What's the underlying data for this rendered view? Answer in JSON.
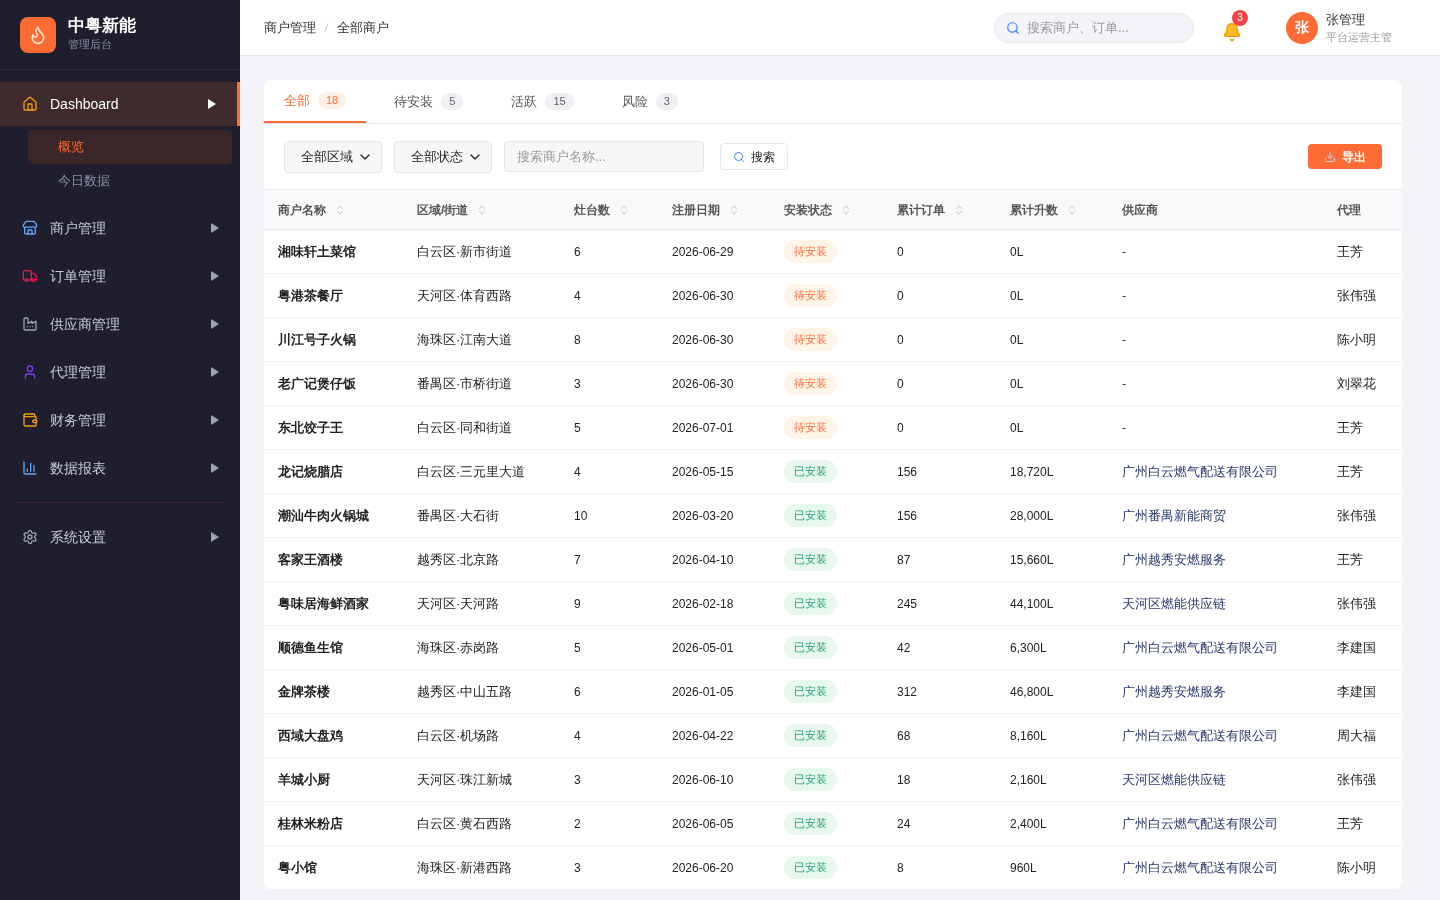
{
  "brand": {
    "name": "中粤新能",
    "subtitle": "管理后台"
  },
  "sidebar": {
    "items": [
      {
        "label": "Dashboard",
        "selected": true,
        "expanded": true,
        "children": [
          {
            "label": "概览",
            "selected": true
          },
          {
            "label": "今日数据",
            "selected": false
          }
        ]
      },
      {
        "label": "商户管理",
        "selected": false,
        "expanded": false
      },
      {
        "label": "订单管理",
        "selected": false,
        "expanded": false
      },
      {
        "label": "供应商管理",
        "selected": false,
        "expanded": false
      },
      {
        "label": "代理管理",
        "selected": false,
        "expanded": false
      },
      {
        "label": "财务管理",
        "selected": false,
        "expanded": false
      },
      {
        "label": "数据报表",
        "selected": false,
        "expanded": false
      }
    ],
    "footer_items": [
      {
        "label": "系统设置",
        "selected": false,
        "expanded": false
      }
    ]
  },
  "breadcrumb": [
    "商户管理",
    "全部商户"
  ],
  "header": {
    "search_placeholder": "搜索商户、订单...",
    "notifications": "3",
    "user": {
      "avatar": "张",
      "name": "张管理",
      "role": "平台运营主管"
    }
  },
  "tabs": [
    {
      "label": "全部",
      "count": "18",
      "selected": true
    },
    {
      "label": "待安装",
      "count": "5",
      "selected": false
    },
    {
      "label": "活跃",
      "count": "15",
      "selected": false
    },
    {
      "label": "风险",
      "count": "3",
      "selected": false
    }
  ],
  "filters": {
    "region": "全部区域",
    "status": "全部状态",
    "search_placeholder": "搜索商户名称...",
    "search_button": "搜索",
    "export_button": "导出"
  },
  "table": {
    "columns": [
      {
        "label": "商户名称",
        "sortable": true
      },
      {
        "label": "区域/街道",
        "sortable": true
      },
      {
        "label": "灶台数",
        "sortable": true
      },
      {
        "label": "注册日期",
        "sortable": true
      },
      {
        "label": "安装状态",
        "sortable": true
      },
      {
        "label": "累计订单",
        "sortable": true
      },
      {
        "label": "累计升数",
        "sortable": true
      },
      {
        "label": "供应商",
        "sortable": false
      },
      {
        "label": "代理",
        "sortable": false
      }
    ],
    "rows": [
      {
        "name": "湘味轩土菜馆",
        "area": "白云区·新市街道",
        "stoves": "6",
        "date": "2026-06-29",
        "status": {
          "kind": "pending",
          "label": "待安装"
        },
        "orders": "0",
        "liters": "0L",
        "supplier": "-",
        "agent": "王芳"
      },
      {
        "name": "粤港茶餐厅",
        "area": "天河区·体育西路",
        "stoves": "4",
        "date": "2026-06-30",
        "status": {
          "kind": "pending",
          "label": "待安装"
        },
        "orders": "0",
        "liters": "0L",
        "supplier": "-",
        "agent": "张伟强"
      },
      {
        "name": "川江号子火锅",
        "area": "海珠区·江南大道",
        "stoves": "8",
        "date": "2026-06-30",
        "status": {
          "kind": "pending",
          "label": "待安装"
        },
        "orders": "0",
        "liters": "0L",
        "supplier": "-",
        "agent": "陈小明"
      },
      {
        "name": "老广记煲仔饭",
        "area": "番禺区·市桥街道",
        "stoves": "3",
        "date": "2026-06-30",
        "status": {
          "kind": "pending",
          "label": "待安装"
        },
        "orders": "0",
        "liters": "0L",
        "supplier": "-",
        "agent": "刘翠花"
      },
      {
        "name": "东北饺子王",
        "area": "白云区·同和街道",
        "stoves": "5",
        "date": "2026-07-01",
        "status": {
          "kind": "pending",
          "label": "待安装"
        },
        "orders": "0",
        "liters": "0L",
        "supplier": "-",
        "agent": "王芳"
      },
      {
        "name": "龙记烧腊店",
        "area": "白云区·三元里大道",
        "stoves": "4",
        "date": "2026-05-15",
        "status": {
          "kind": "installed",
          "label": "已安装"
        },
        "orders": "156",
        "liters": "18,720L",
        "supplier": "广州白云燃气配送有限公司",
        "agent": "王芳"
      },
      {
        "name": "潮汕牛肉火锅城",
        "area": "番禺区·大石街",
        "stoves": "10",
        "date": "2026-03-20",
        "status": {
          "kind": "installed",
          "label": "已安装"
        },
        "orders": "156",
        "liters": "28,000L",
        "supplier": "广州番禺新能商贸",
        "agent": "张伟强"
      },
      {
        "name": "客家王酒楼",
        "area": "越秀区·北京路",
        "stoves": "7",
        "date": "2026-04-10",
        "status": {
          "kind": "installed",
          "label": "已安装"
        },
        "orders": "87",
        "liters": "15,660L",
        "supplier": "广州越秀安燃服务",
        "agent": "王芳"
      },
      {
        "name": "粤味居海鲜酒家",
        "area": "天河区·天河路",
        "stoves": "9",
        "date": "2026-02-18",
        "status": {
          "kind": "installed",
          "label": "已安装"
        },
        "orders": "245",
        "liters": "44,100L",
        "supplier": "天河区燃能供应链",
        "agent": "张伟强"
      },
      {
        "name": "顺德鱼生馆",
        "area": "海珠区·赤岗路",
        "stoves": "5",
        "date": "2026-05-01",
        "status": {
          "kind": "installed",
          "label": "已安装"
        },
        "orders": "42",
        "liters": "6,300L",
        "supplier": "广州白云燃气配送有限公司",
        "agent": "李建国"
      },
      {
        "name": "金牌茶楼",
        "area": "越秀区·中山五路",
        "stoves": "6",
        "date": "2026-01-05",
        "status": {
          "kind": "installed",
          "label": "已安装"
        },
        "orders": "312",
        "liters": "46,800L",
        "supplier": "广州越秀安燃服务",
        "agent": "李建国"
      },
      {
        "name": "西域大盘鸡",
        "area": "白云区·机场路",
        "stoves": "4",
        "date": "2026-04-22",
        "status": {
          "kind": "installed",
          "label": "已安装"
        },
        "orders": "68",
        "liters": "8,160L",
        "supplier": "广州白云燃气配送有限公司",
        "agent": "周大福"
      },
      {
        "name": "羊城小厨",
        "area": "天河区·珠江新城",
        "stoves": "3",
        "date": "2026-06-10",
        "status": {
          "kind": "installed",
          "label": "已安装"
        },
        "orders": "18",
        "liters": "2,160L",
        "supplier": "天河区燃能供应链",
        "agent": "张伟强"
      },
      {
        "name": "桂林米粉店",
        "area": "白云区·黄石西路",
        "stoves": "2",
        "date": "2026-06-05",
        "status": {
          "kind": "installed",
          "label": "已安装"
        },
        "orders": "24",
        "liters": "2,400L",
        "supplier": "广州白云燃气配送有限公司",
        "agent": "王芳"
      },
      {
        "name": "粤小馆",
        "area": "海珠区·新港西路",
        "stoves": "3",
        "date": "2026-06-20",
        "status": {
          "kind": "installed",
          "label": "已安装"
        },
        "orders": "8",
        "liters": "960L",
        "supplier": "广州白云燃气配送有限公司",
        "agent": "陈小明"
      }
    ]
  }
}
